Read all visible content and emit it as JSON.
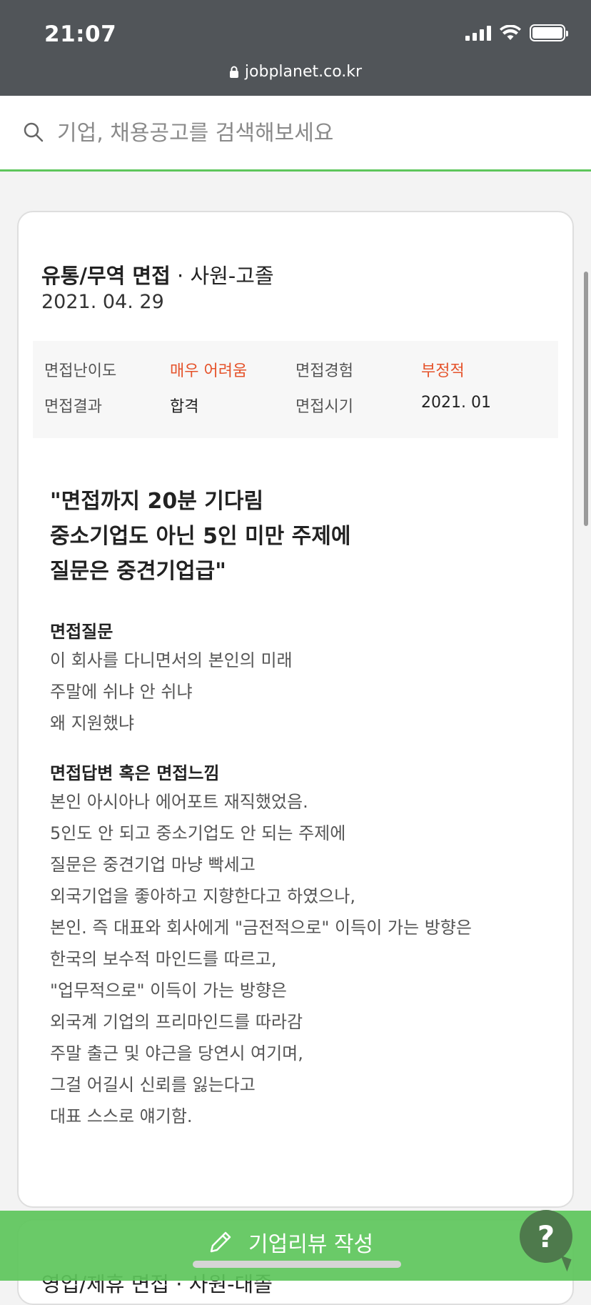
{
  "status_bar": {
    "time": "21:07",
    "url": "jobplanet.co.kr"
  },
  "search": {
    "placeholder": "기업, 채용공고를 검색해보세요"
  },
  "review": {
    "category": "유통/무역 면접",
    "separator": " · ",
    "position": "사원-고졸",
    "date": "2021. 04. 29",
    "info": {
      "difficulty_label": "면접난이도",
      "difficulty_value": "매우 어려움",
      "experience_label": "면접경험",
      "experience_value": "부정적",
      "result_label": "면접결과",
      "result_value": "합격",
      "period_label": "면접시기",
      "period_value": "2021. 01"
    },
    "headline": [
      "\"면접까지 20분 기다림",
      "중소기업도 아닌 5인 미만 주제에",
      "질문은 중견기업급\""
    ],
    "questions_title": "면접질문",
    "questions": [
      "이 회사를 다니면서의 본인의 미래",
      "주말에 쉬냐 안 쉬냐",
      "왜 지원했냐"
    ],
    "answer_title": "면접답변 혹은 면접느낌",
    "answers": [
      "본인 아시아나 에어포트 재직했었음.",
      "5인도 안 되고 중소기업도 안 되는 주제에",
      "질문은 중견기업 마냥 빡세고",
      "외국기업을 좋아하고 지향한다고 하였으나,",
      "본인. 즉 대표와 회사에게 \"금전적으로\" 이득이 가는 방향은",
      "한국의 보수적 마인드를 따르고,",
      "\"업무적으로\" 이득이 가는 방향은",
      "외국계 기업의 프리마인드를 따라감",
      "주말 출근 및 야근을 당연시 여기며,",
      "그걸 어길시 신뢰를 잃는다고",
      "대표 스스로 얘기함."
    ]
  },
  "next_review_peek": "영업/제휴 면접 · 사원-대졸",
  "bottom": {
    "write_label": "기업리뷰 작성",
    "help_label": "?"
  },
  "colors": {
    "accent": "#5dc65b",
    "negative": "#e5532b",
    "statusbar": "#515559"
  }
}
